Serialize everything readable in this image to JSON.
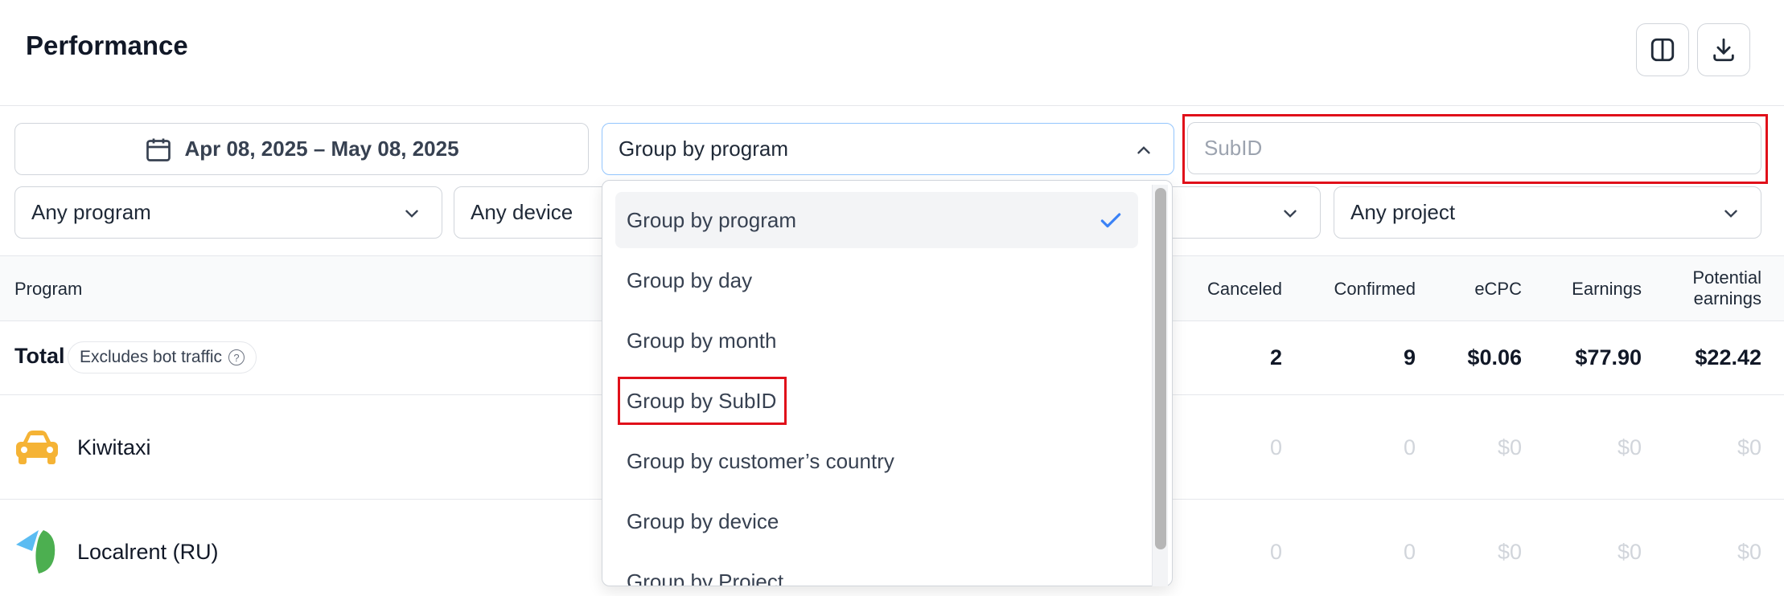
{
  "header": {
    "title": "Performance",
    "columns_icon": "columns-icon",
    "download_icon": "download-icon"
  },
  "filters": {
    "date_range": "Apr 08, 2025 – May 08, 2025",
    "group_by": "Group by program",
    "subid_placeholder": "SubID",
    "program": "Any program",
    "device": "Any device",
    "project": "Any project"
  },
  "dropdown": {
    "options": [
      "Group by program",
      "Group by day",
      "Group by month",
      "Group by SubID",
      "Group by customer’s country",
      "Group by device",
      "Group by Project"
    ],
    "selected": "Group by program"
  },
  "table": {
    "headers": {
      "program": "Program",
      "canceled": "Canceled",
      "confirmed": "Confirmed",
      "ecpc": "eCPC",
      "earnings": "Earnings",
      "potential_line1": "Potential",
      "potential_line2": "earnings"
    },
    "total": {
      "label": "Total",
      "badge": "Excludes bot traffic",
      "canceled": "2",
      "confirmed": "9",
      "ecpc": "$0.06",
      "earnings": "$77.90",
      "potential": "$22.42"
    },
    "rows": [
      {
        "name": "Kiwitaxi",
        "icon": "taxi-icon",
        "canceled": "0",
        "confirmed": "0",
        "ecpc": "$0",
        "earnings": "$0",
        "potential": "$0"
      },
      {
        "name": "Localrent (RU)",
        "icon": "localrent-logo-icon",
        "canceled": "0",
        "confirmed": "0",
        "ecpc": "$0",
        "earnings": "$0",
        "potential": "$0"
      }
    ]
  },
  "colors": {
    "accent_blue": "#3b82f6",
    "highlight_red": "#e0101a",
    "taxi_yellow": "#f5b335",
    "localrent_green": "#4caf50",
    "localrent_blue": "#5bbcf2"
  }
}
